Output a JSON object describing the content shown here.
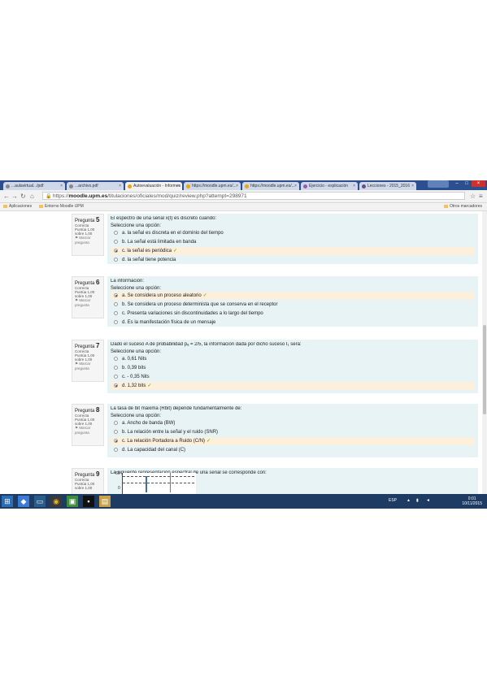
{
  "browser": {
    "tabs": [
      {
        "label": "...aulavirtual.../pdf",
        "active": false
      },
      {
        "label": "...archivo.pdf",
        "active": false
      },
      {
        "label": "Autoevaluación - Informes",
        "active": true
      },
      {
        "label": "https://moodle.upm.es/...",
        "active": false
      },
      {
        "label": "https://moodle.upm.es/...",
        "active": false
      },
      {
        "label": "Ejercicio - explicación",
        "active": false
      },
      {
        "label": "Lecciones - 2015_2016",
        "active": false
      }
    ],
    "window_buttons": {
      "minimize": "–",
      "maximize": "□",
      "close": "×"
    },
    "url_prefix": "https://",
    "url_domain": "moodle.upm.es",
    "url_path": "/titulaciones/oficiales/mod/quiz/review.php?attempt=298971",
    "bookmarks": [
      {
        "label": "Aplicaciones"
      },
      {
        "label": "Entorno Moodle UPM"
      }
    ],
    "other_bookmarks": "Otros marcadores"
  },
  "questions": [
    {
      "number": "5",
      "status": "Correcta",
      "grade": "Puntúa 1,00 sobre 1,00",
      "flag": "Marcar pregunta",
      "text": "El espectro de una señal x(t) es discreto cuando:",
      "prompt": "Seleccione una opción:",
      "options": [
        {
          "label": "a. la señal es discreta en el dominio del tiempo",
          "selected": false,
          "correct": false
        },
        {
          "label": "b. La señal está limitada en banda",
          "selected": false,
          "correct": false
        },
        {
          "label": "c. la señal es periódica",
          "selected": true,
          "correct": true
        },
        {
          "label": "d. la señal tiene potencia",
          "selected": false,
          "correct": false
        }
      ]
    },
    {
      "number": "6",
      "status": "Correcta",
      "grade": "Puntúa 1,00 sobre 1,00",
      "flag": "Marcar pregunta",
      "text": "La información:",
      "prompt": "Seleccione una opción:",
      "options": [
        {
          "label": "a. Se considera un proceso aleatorio",
          "selected": true,
          "correct": true
        },
        {
          "label": "b. Se considera un proceso determinista que se conserva en el receptor",
          "selected": false,
          "correct": false
        },
        {
          "label": "c. Presenta variaciones sin discontinuidades a lo largo del tiempo",
          "selected": false,
          "correct": false
        },
        {
          "label": "d. Es la manifestación física de un mensaje",
          "selected": false,
          "correct": false
        }
      ]
    },
    {
      "number": "7",
      "status": "Correcta",
      "grade": "Puntúa 1,00 sobre 1,00",
      "flag": "Marcar pregunta",
      "text": "Dado el suceso A de probabilidad pₐ = 2/5, la información dada por dicho suceso I₁ será:",
      "prompt": "Seleccione una opción:",
      "options": [
        {
          "label": "a. 0,61 Nits",
          "selected": false,
          "correct": false
        },
        {
          "label": "b. 0,39 bits",
          "selected": false,
          "correct": false
        },
        {
          "label": "c. - 0,35 Nits",
          "selected": false,
          "correct": false
        },
        {
          "label": "d. 1,32 bits",
          "selected": true,
          "correct": true
        }
      ]
    },
    {
      "number": "8",
      "status": "Correcta",
      "grade": "Puntúa 1,00 sobre 1,00",
      "flag": "Marcar pregunta",
      "text": "La tasa de bit máxima (Rbit) depende fundamentalmente de:",
      "prompt": "Seleccione una opción:",
      "options": [
        {
          "label": "a. Ancho de banda (BW)",
          "selected": false,
          "correct": false
        },
        {
          "label": "b. La relación entre la señal y el ruido (SNR)",
          "selected": false,
          "correct": false
        },
        {
          "label": "c. La relación Portadora a Ruido (C/N)",
          "selected": true,
          "correct": true
        },
        {
          "label": "d. La capacidad del canal (C)",
          "selected": false,
          "correct": false
        }
      ]
    },
    {
      "number": "9",
      "status": "Correcta",
      "grade": "Puntúa 1,00 sobre 1,00",
      "text": "La siguiente representación espectral de una señal se corresponde con:"
    }
  ],
  "q9_chart": {
    "y_ticks": [
      "60",
      "0"
    ]
  },
  "taskbar": {
    "tray_language": "ESP",
    "time": "0:01",
    "date": "10/11/2015"
  }
}
